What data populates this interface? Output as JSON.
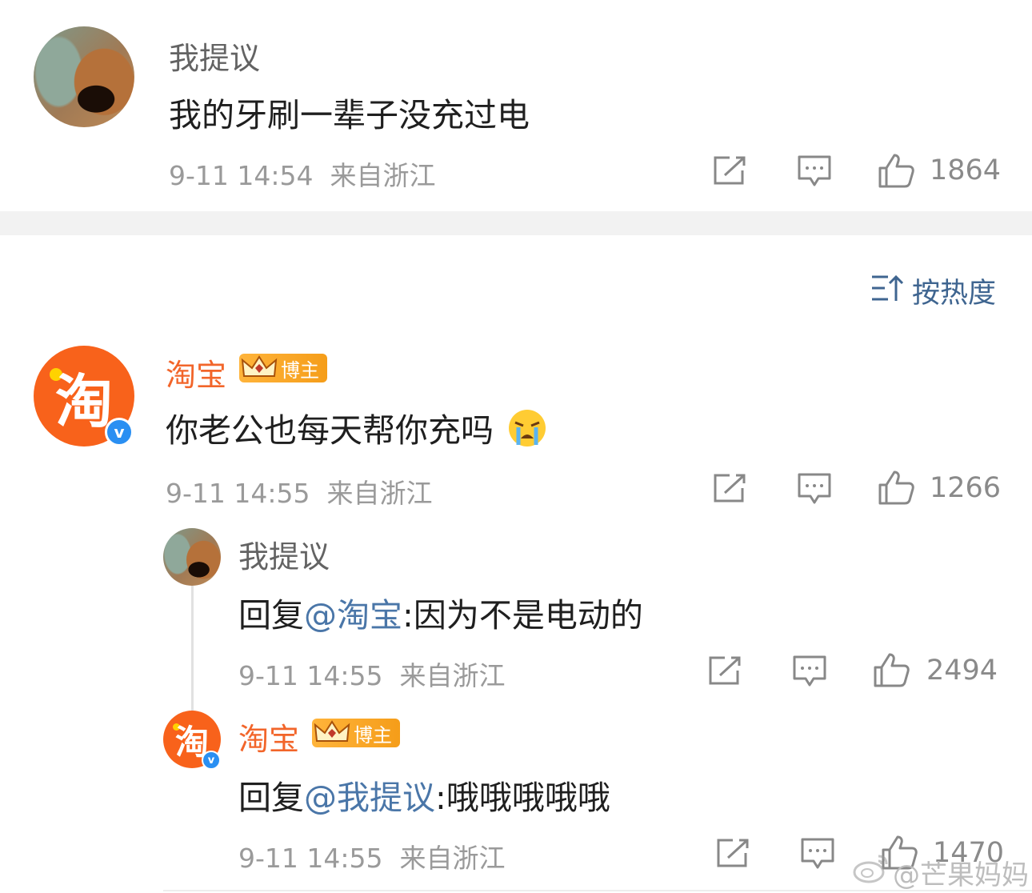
{
  "top_comment": {
    "username": "我提议",
    "text": "我的牙刷一辈子没充过电",
    "time": "9-11 14:54",
    "location": "来自浙江",
    "likes": "1864"
  },
  "sort": {
    "label": "按热度"
  },
  "comments": [
    {
      "username": "淘宝",
      "badge": "博主",
      "text": "你老公也每天帮你充吗",
      "emoji": "crying-face",
      "time": "9-11 14:55",
      "location": "来自浙江",
      "likes": "1266"
    }
  ],
  "replies": [
    {
      "username": "我提议",
      "reply_prefix": "回复",
      "mention": "@淘宝",
      "text": ":因为不是电动的",
      "time": "9-11 14:55",
      "location": "来自浙江",
      "likes": "2494"
    },
    {
      "username": "淘宝",
      "badge": "博主",
      "reply_prefix": "回复",
      "mention": "@我提议",
      "text": ":哦哦哦哦哦",
      "time": "9-11 14:55",
      "location": "来自浙江",
      "likes": "1470"
    }
  ],
  "avatar_glyph": "淘",
  "verified_mark": "v",
  "watermark": "@芒果妈妈",
  "colors": {
    "brand_orange": "#f8621b",
    "name_orange": "#f2652a",
    "mention_blue": "#4a76a8",
    "verified_blue": "#2a8ff2"
  }
}
